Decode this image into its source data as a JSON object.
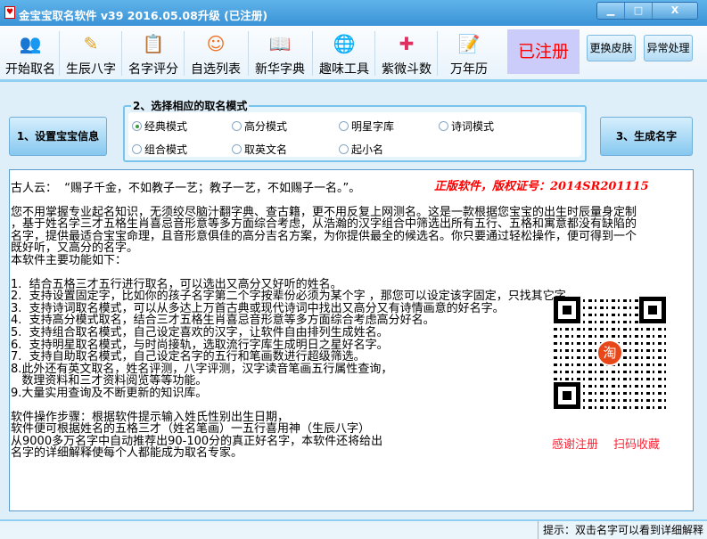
{
  "window": {
    "title": "金宝宝取名软件 v39  2016.05.08升级 (已注册)",
    "logo": "♥",
    "min": "▁",
    "max": "□",
    "close": "X"
  },
  "toolbar": {
    "items": [
      {
        "label": "开始取名",
        "icon": "users-icon",
        "glyph": "👥",
        "color": "#4aa04a"
      },
      {
        "label": "生辰八字",
        "icon": "person-pencil-icon",
        "glyph": "✎",
        "color": "#e0a020"
      },
      {
        "label": "名字评分",
        "icon": "clipboard-icon",
        "glyph": "📋",
        "color": "#b06020"
      },
      {
        "label": "自选列表",
        "icon": "faces-icon",
        "glyph": "☺",
        "color": "#f07020"
      },
      {
        "label": "新华字典",
        "icon": "book-reader-icon",
        "glyph": "📖",
        "color": "#3a8a3a"
      },
      {
        "label": "趣味工具",
        "icon": "globe-icon",
        "glyph": "🌐",
        "color": "#2a7ad0"
      },
      {
        "label": "紫微斗数",
        "icon": "person-plus-icon",
        "glyph": "✚",
        "color": "#e03060"
      },
      {
        "label": "万年历",
        "icon": "calendar-pencil-icon",
        "glyph": "📝",
        "color": "#3a6ad0"
      }
    ],
    "registered": "已注册",
    "change_skin": "更换皮肤",
    "exception": "异常处理"
  },
  "steps": {
    "step1": "1、设置宝宝信息",
    "step2_legend": "2、选择相应的取名模式",
    "step3": "3、生成名字",
    "modes": [
      {
        "label": "经典模式",
        "checked": true
      },
      {
        "label": "高分模式",
        "checked": false
      },
      {
        "label": "明星字库",
        "checked": false
      },
      {
        "label": "诗词模式",
        "checked": false
      },
      {
        "label": "组合模式",
        "checked": false
      },
      {
        "label": "取英文名",
        "checked": false
      },
      {
        "label": "起小名",
        "checked": false
      }
    ]
  },
  "content": {
    "quote": "古人云：  “赐子千金，不如教子一艺；教子一艺，不如赐子一名。”。",
    "copyright": "正版软件，版权证号：2014SR201115",
    "intro": "您不用掌握专业起名知识，无须绞尽脑汁翻字典、查古籍，更不用反复上网测名。这是一款根据您宝宝的出生时辰量身定制\n，基于姓名学三才五格生肖喜忌音形意等多方面综合考虑，从浩瀚的汉字组合中筛选出所有五行、五格和寓意都没有缺陷的\n名字，提供最适合宝宝命理，且音形意俱佳的高分吉名方案，为你提供最全的候选名。你只要通过轻松操作，便可得到一个\n既好听，又高分的名字。\n本软件主要功能如下：",
    "features": "1.  结合五格三才五行进行取名，可以选出又高分又好听的姓名。\n2.  支持设置固定字，比如你的孩子名字第二个字按辈份必须为某个字 ，那您可以设定该字固定，只找其它字。\n3.  支持诗词取名模式，可以从多达上万首古典或现代诗词中找出又高分又有诗情画意的好名字。\n4.  支持高分模式取名，结合三才五格生肖喜忌音形意等多方面综合考虑高分好名。\n5.  支持组合取名模式，自己设定喜欢的汉字，让软件自由排列生成姓名。\n6.  支持明星取名模式，与时尚接轨，选取流行字库生成明日之星好名字。\n7.  支持自助取名模式，自己设定名字的五行和笔画数进行超级筛选。\n8.此外还有英文取名，姓名评测，八字评测，汉字读音笔画五行属性查询，\n   数理资料和三才资料阅览等等功能。\n9.大量实用查询及不断更新的知识库。",
    "steps_text": "软件操作步骤：根据软件提示输入姓氏性别出生日期，\n软件便可根据姓名的五格三才（姓名笔画）一五行喜用神（生辰八字）\n从9000多万名字中自动推荐出90-100分的真正好名字，本软件还将给出\n名字的详细解释使每个人都能成为取名专家。",
    "qr_logo": "淘",
    "qr_thanks": "感谢注册",
    "qr_scan": "扫码收藏"
  },
  "status": {
    "tip": "提示：双击名字可以看到详细解释"
  }
}
